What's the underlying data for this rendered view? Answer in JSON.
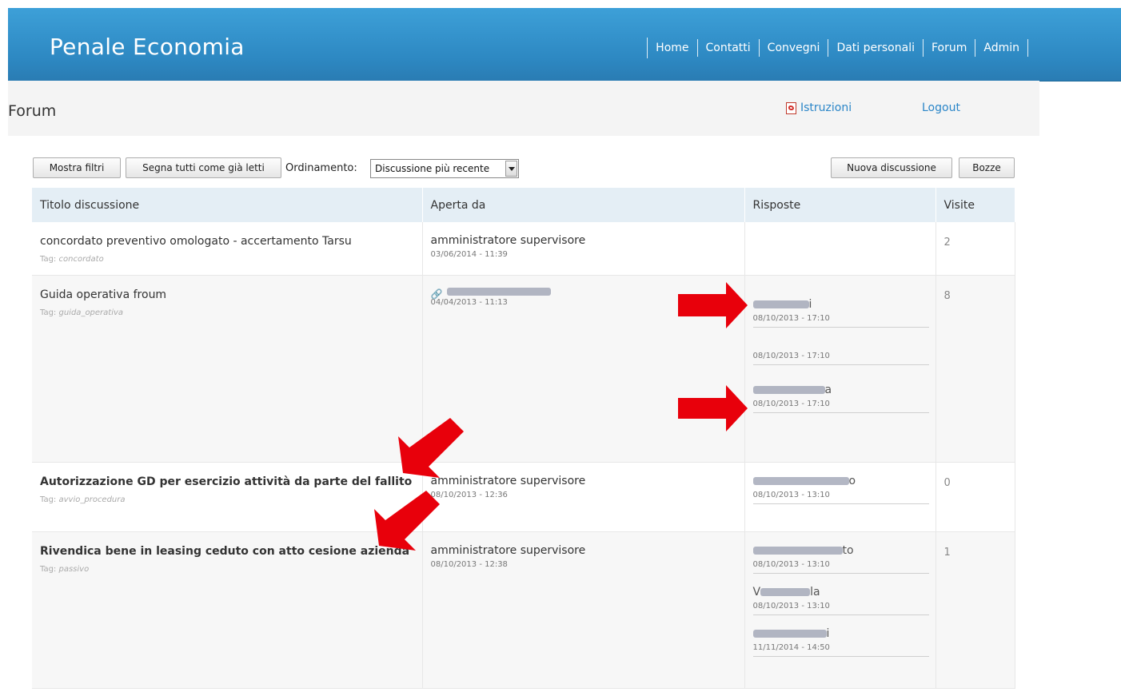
{
  "header": {
    "brand": "Penale Economia",
    "nav": [
      "Home",
      "Contatti",
      "Convegni",
      "Dati personali",
      "Forum",
      "Admin"
    ]
  },
  "subbar": {
    "title": "Forum",
    "istruzioni": "Istruzioni",
    "logout": "Logout"
  },
  "toolbar": {
    "filters": "Mostra filtri",
    "mark_read": "Segna tutti come già letti",
    "ordering_label": "Ordinamento:",
    "ordering_value": "Discussione più recente",
    "new_discussion": "Nuova discussione",
    "drafts": "Bozze"
  },
  "table": {
    "headers": [
      "Titolo discussione",
      "Aperta da",
      "Risposte",
      "Visite"
    ],
    "tag_label": "Tag:",
    "rows": [
      {
        "title": "concordato preventivo omologato - accertamento Tarsu",
        "tag": "concordato",
        "author": "amministratore supervisore",
        "date": "03/06/2014 - 11:39",
        "visits": "2"
      },
      {
        "title": "Guida operativa froum",
        "tag": "guida_operativa",
        "author": "",
        "date": "04/04/2013 - 11:13",
        "replies": [
          {
            "name": "i",
            "date": "08/10/2013 - 17:10"
          },
          {
            "name": "",
            "date": "08/10/2013 - 17:10"
          },
          {
            "name": "a",
            "date": "08/10/2013 - 17:10"
          }
        ],
        "visits": "8"
      },
      {
        "title": "Autorizzazione GD per esercizio attività da parte del fallito",
        "tag": "avvio_procedura",
        "author": "amministratore supervisore",
        "date": "08/10/2013 - 12:36",
        "replies": [
          {
            "name": "o",
            "date": "08/10/2013 - 13:10"
          }
        ],
        "visits": "0"
      },
      {
        "title": "Rivendica bene in leasing ceduto con atto cesione azienda",
        "tag": "passivo",
        "author": "amministratore supervisore",
        "date": "08/10/2013 - 12:38",
        "replies": [
          {
            "name": "to",
            "date": "08/10/2013 - 13:10"
          },
          {
            "name": "la",
            "date": "08/10/2013 - 13:10"
          },
          {
            "name": "i",
            "date": "11/11/2014 - 14:50"
          }
        ],
        "visits": "1"
      }
    ]
  },
  "colors": {
    "header_bg": "#2d88c2",
    "link": "#2b86c8",
    "arrow": "#e8000b"
  },
  "icons": [
    "pdf-icon",
    "paperclip-icon",
    "dropdown-arrow-icon",
    "red-arrow-annotation"
  ]
}
